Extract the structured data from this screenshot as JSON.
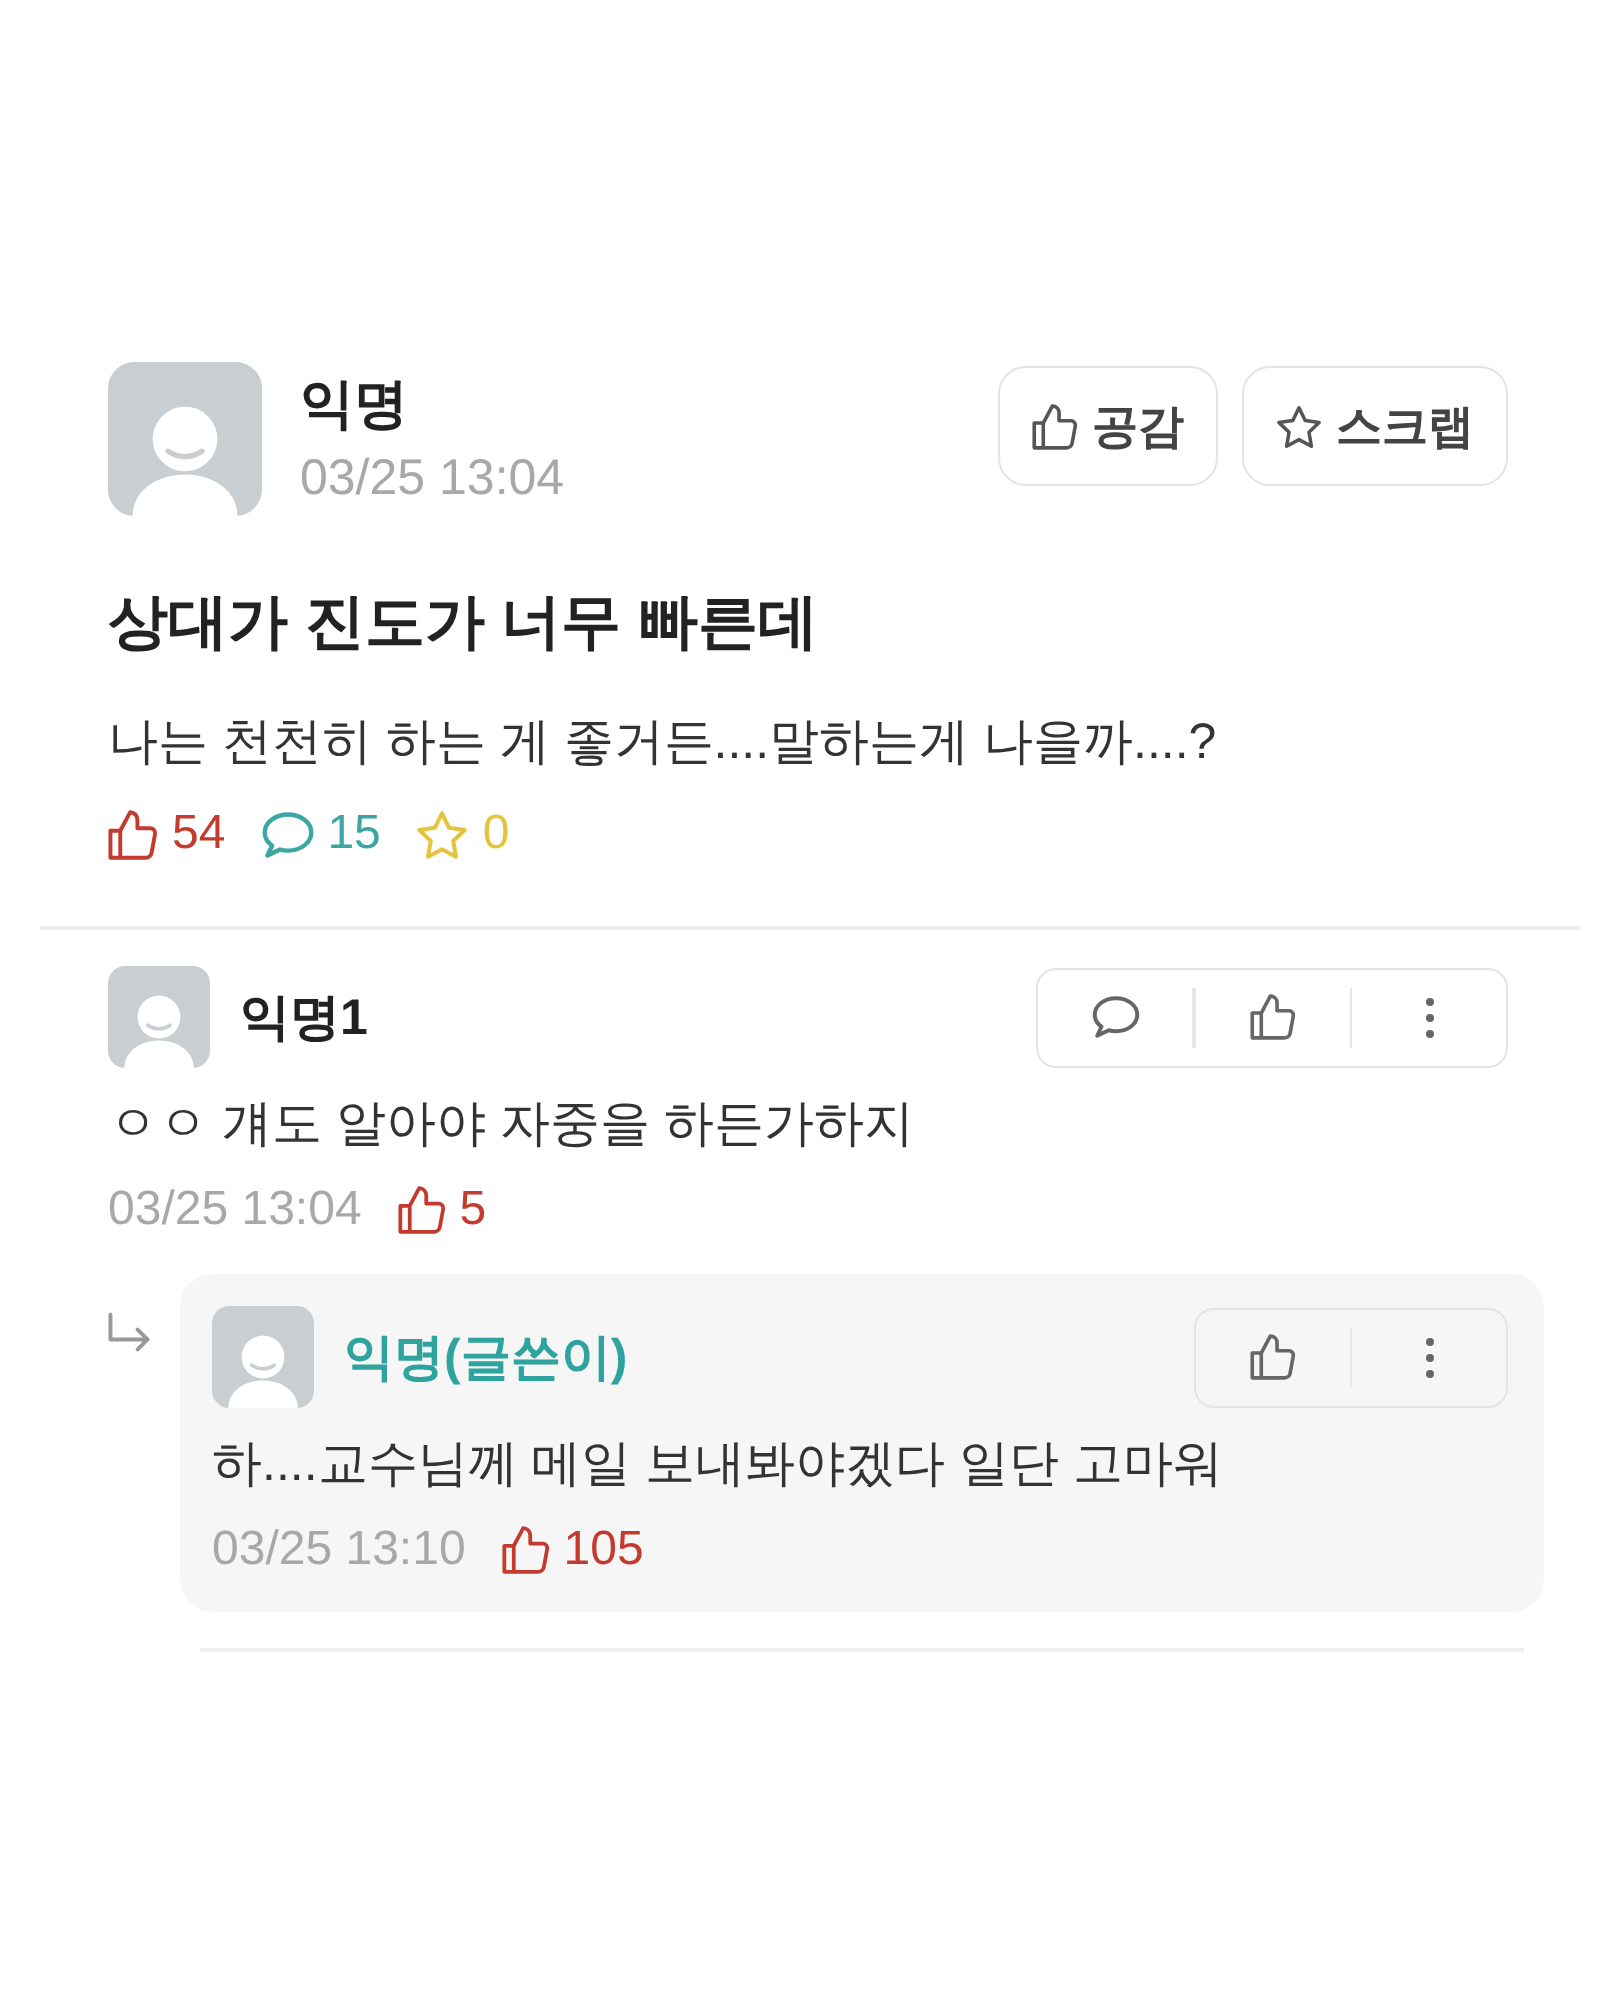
{
  "post": {
    "author": "익명",
    "time": "03/25 13:04",
    "buttons": [
      {
        "kind": "like",
        "label": "공감"
      },
      {
        "kind": "scrap",
        "label": "스크랩"
      }
    ],
    "title": "상대가 진도가 너무 빠른데",
    "body": "나는 천천히 하는 게 좋거든....말하는게 나을까....?",
    "stats": [
      {
        "kind": "like",
        "count": "54"
      },
      {
        "kind": "comment",
        "count": "15"
      },
      {
        "kind": "scrap",
        "count": "0"
      }
    ]
  },
  "comments": [
    {
      "author": "익명1",
      "writer": false,
      "actions": [
        {
          "kind": "reply"
        },
        {
          "kind": "like"
        },
        {
          "kind": "more"
        }
      ],
      "text": "ㅇㅇ 걔도 알아야 자중을 하든가하지",
      "time": "03/25 13:04",
      "likes": "5",
      "children": [
        {
          "author": "익명(글쓴이)",
          "writer": true,
          "actions": [
            {
              "kind": "like"
            },
            {
              "kind": "more"
            }
          ],
          "text": "하....교수님께 메일 보내봐야겠다 일단 고마워",
          "time": "03/25 13:10",
          "likes": "105"
        }
      ]
    }
  ]
}
